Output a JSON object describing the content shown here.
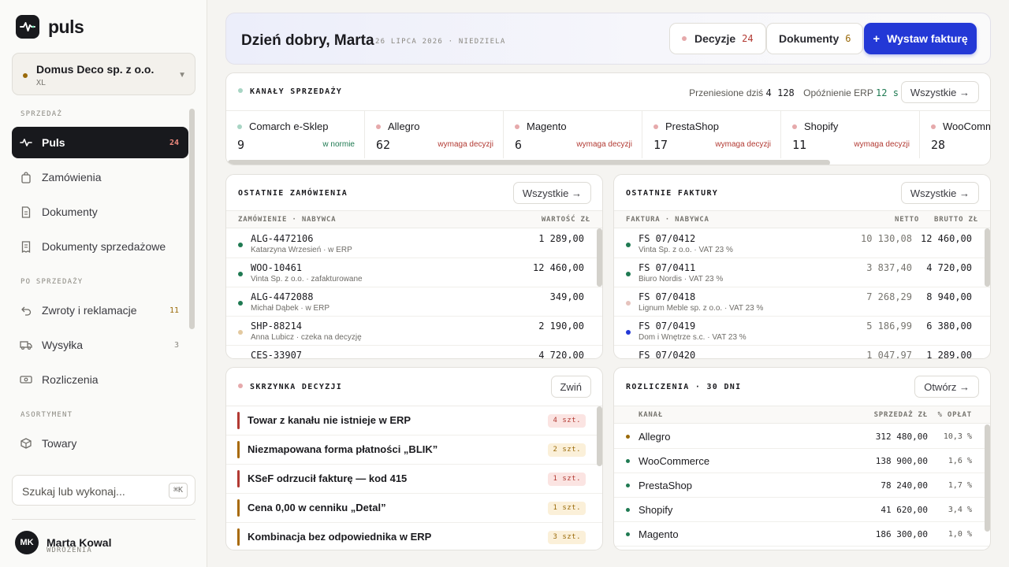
{
  "app": {
    "name": "puls"
  },
  "company": {
    "name": "Domus Deco sp. z o.o.",
    "size": "XL"
  },
  "nav": {
    "section_sales": "SPRZEDAŻ",
    "section_after": "PO SPRZEDAŻY",
    "section_assortment": "ASORTYMENT",
    "items": [
      {
        "label": "Puls",
        "count": "24"
      },
      {
        "label": "Zamówienia",
        "count": ""
      },
      {
        "label": "Dokumenty",
        "count": ""
      },
      {
        "label": "Dokumenty sprzedażowe",
        "count": ""
      },
      {
        "label": "Zwroty i reklamacje",
        "count": "11"
      },
      {
        "label": "Wysyłka",
        "count": "3"
      },
      {
        "label": "Rozliczenia",
        "count": ""
      },
      {
        "label": "Towary",
        "count": ""
      }
    ]
  },
  "search": {
    "placeholder": "Szukaj lub wykonaj...",
    "shortcut": "⌘K"
  },
  "user": {
    "initials": "MK",
    "name": "Marta Kowal",
    "role": "WDROŻENIA"
  },
  "header": {
    "greeting": "Dzień dobry, Marta",
    "date": "26 LIPCA 2026 · NIEDZIELA",
    "decisions_label": "Decyzje",
    "decisions_count": "24",
    "documents_label": "Dokumenty",
    "documents_count": "6",
    "invoice_button": "Wystaw fakturę"
  },
  "channels": {
    "title": "KANAŁY SPRZEDAŻY",
    "moved_label": "Przeniesione dziś",
    "moved_a": "4",
    "moved_b": "128",
    "erp_delay_label": "Opóźnienie ERP",
    "erp_delay_value": "12",
    "erp_delay_unit": "s",
    "all_button": "Wszystkie →",
    "items": [
      {
        "name": "Comarch e-Sklep",
        "count": "9",
        "status": "w normie",
        "dot": "#a8d5c4",
        "status_color": "#1f7a52"
      },
      {
        "name": "Allegro",
        "count": "62",
        "status": "wymaga decyzji",
        "dot": "#e6a9ab",
        "status_color": "#b23a33"
      },
      {
        "name": "Magento",
        "count": "6",
        "status": "wymaga decyzji",
        "dot": "#e6a9ab",
        "status_color": "#b23a33"
      },
      {
        "name": "PrestaShop",
        "count": "17",
        "status": "wymaga decyzji",
        "dot": "#e6a9ab",
        "status_color": "#b23a33"
      },
      {
        "name": "Shopify",
        "count": "11",
        "status": "wymaga decyzji",
        "dot": "#e6a9ab",
        "status_color": "#b23a33"
      },
      {
        "name": "WooCommerce",
        "count": "28",
        "status": "",
        "dot": "#e6a9ab",
        "status_color": "#b23a33"
      }
    ]
  },
  "orders": {
    "title": "OSTATNIE ZAMÓWIENIA",
    "all_button": "Wszystkie →",
    "col_order": "ZAMÓWIENIE · NABYWCA",
    "col_value": "WARTOŚĆ ZŁ",
    "rows": [
      {
        "id": "ALG-4472106",
        "sub": "Katarzyna Wrzesień · w ERP",
        "value": "1 289,00",
        "dot": "#1f7a52"
      },
      {
        "id": "WOO-10461",
        "sub": "Vinta Sp. z o.o. · zafakturowane",
        "value": "12 460,00",
        "dot": "#1f7a52"
      },
      {
        "id": "ALG-4472088",
        "sub": "Michał Dąbek · w ERP",
        "value": "349,00",
        "dot": "#1f7a52"
      },
      {
        "id": "SHP-88214",
        "sub": "Anna Lubicz · czeka na decyzję",
        "value": "2 190,00",
        "dot": "#e3c9a0"
      },
      {
        "id": "CES-33907",
        "sub": "",
        "value": "4 720,00",
        "dot": "#1f7a52"
      }
    ]
  },
  "invoices": {
    "title": "OSTATNIE FAKTURY",
    "all_button": "Wszystkie →",
    "col_invoice": "FAKTURA · NABYWCA",
    "col_net": "NETTO",
    "col_gross": "BRUTTO ZŁ",
    "rows": [
      {
        "id": "FS 07/0412",
        "sub": "Vinta Sp. z o.o. · VAT 23 %",
        "net": "10 130,08",
        "gross": "12 460,00",
        "dot": "#1f7a52"
      },
      {
        "id": "FS 07/0411",
        "sub": "Biuro Nordis · VAT 23 %",
        "net": "3 837,40",
        "gross": "4 720,00",
        "dot": "#1f7a52"
      },
      {
        "id": "FS 07/0418",
        "sub": "Lignum Meble sp. z o.o. · VAT 23 %",
        "net": "7 268,29",
        "gross": "8 940,00",
        "dot": "#e6c3bd"
      },
      {
        "id": "FS 07/0419",
        "sub": "Dom i Wnętrze s.c. · VAT 23 %",
        "net": "5 186,99",
        "gross": "6 380,00",
        "dot": "#2338d6"
      },
      {
        "id": "FS 07/0420",
        "sub": "",
        "net": "1 047,97",
        "gross": "1 289,00",
        "dot": "#1f7a52"
      }
    ]
  },
  "decisions": {
    "title": "SKRZYNKA DECYZJI",
    "collapse_button": "Zwiń",
    "rows": [
      {
        "text": "Towar z kanału nie istnieje w ERP",
        "badge": "4 szt.",
        "bar": "#b23a33",
        "badge_bg": "#fbe4e2",
        "badge_fg": "#b23a33"
      },
      {
        "text": "Niezmapowana forma płatności „BLIK”",
        "badge": "2 szt.",
        "bar": "#a86a0a",
        "badge_bg": "#fbf0d9",
        "badge_fg": "#9a6a0a"
      },
      {
        "text": "KSeF odrzucił fakturę — kod 415",
        "badge": "1 szt.",
        "bar": "#b23a33",
        "badge_bg": "#fbe4e2",
        "badge_fg": "#b23a33"
      },
      {
        "text": "Cena 0,00 w cenniku „Detal”",
        "badge": "1 szt.",
        "bar": "#a86a0a",
        "badge_bg": "#fbf0d9",
        "badge_fg": "#9a6a0a"
      },
      {
        "text": "Kombinacja bez odpowiednika w ERP",
        "badge": "3 szt.",
        "bar": "#a86a0a",
        "badge_bg": "#fbf0d9",
        "badge_fg": "#9a6a0a"
      }
    ]
  },
  "settlements": {
    "title": "ROZLICZENIA · 30 DNI",
    "open_button": "Otwórz →",
    "col_channel": "KANAŁ",
    "col_sales": "SPRZEDAŻ ZŁ",
    "col_fee": "% OPŁAT",
    "rows": [
      {
        "name": "Allegro",
        "sales": "312 480,00",
        "fee": "10,3 %",
        "dot": "#9a6a0a"
      },
      {
        "name": "WooCommerce",
        "sales": "138 900,00",
        "fee": "1,6 %",
        "dot": "#1f7a52"
      },
      {
        "name": "PrestaShop",
        "sales": "78 240,00",
        "fee": "1,7 %",
        "dot": "#1f7a52"
      },
      {
        "name": "Shopify",
        "sales": "41 620,00",
        "fee": "3,4 %",
        "dot": "#1f7a52"
      },
      {
        "name": "Magento",
        "sales": "186 300,00",
        "fee": "1,0 %",
        "dot": "#1f7a52"
      }
    ]
  },
  "colors": {
    "accent": "#2338d6",
    "ok": "#1f7a52",
    "warn": "#b23a33",
    "amber": "#9a6a0a",
    "dark": "#18191d"
  }
}
